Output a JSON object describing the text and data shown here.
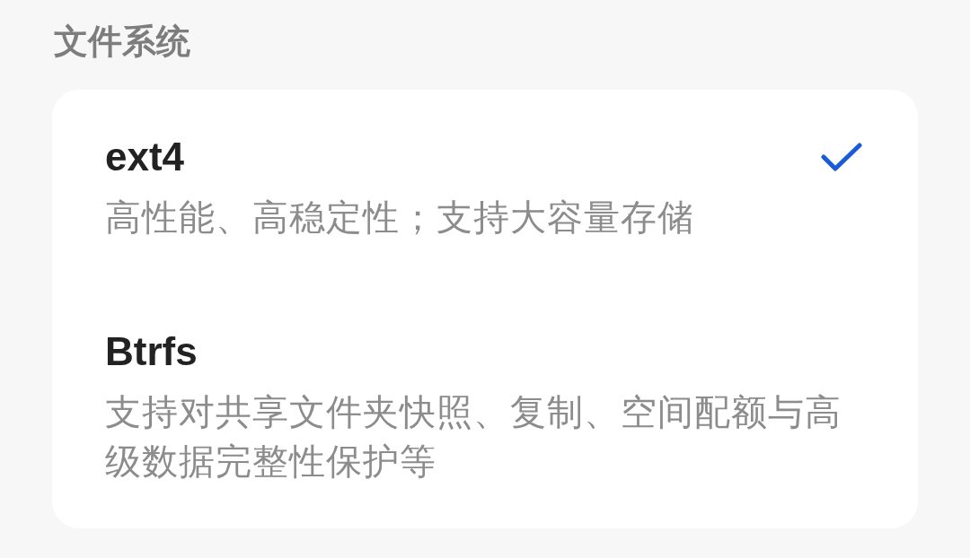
{
  "section": {
    "title": "文件系统"
  },
  "options": [
    {
      "name": "ext4",
      "description": "高性能、高稳定性；支持大容量存储",
      "selected": true
    },
    {
      "name": "Btrfs",
      "description": "支持对共享文件夹快照、复制、空间配额与高级数据完整性保护等",
      "selected": false
    }
  ]
}
